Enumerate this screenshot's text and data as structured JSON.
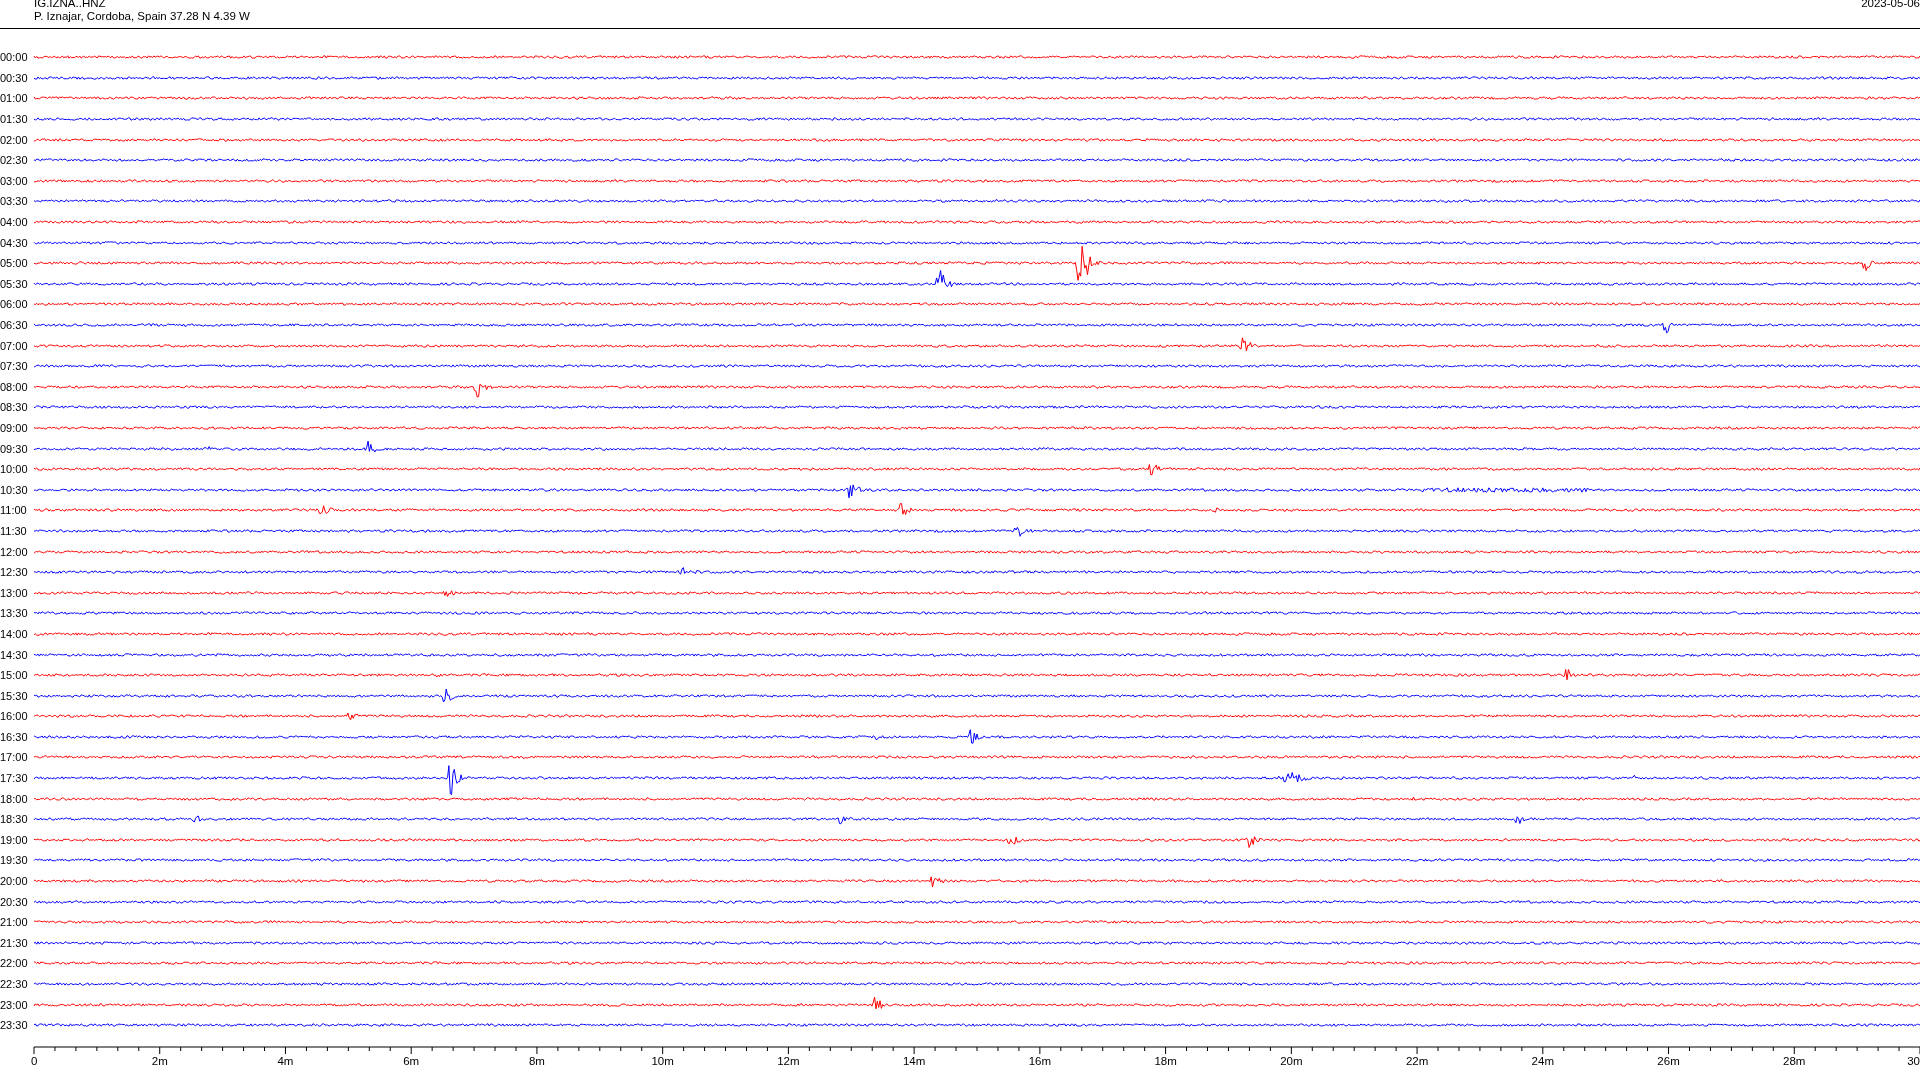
{
  "header": {
    "station": "IG.IZNA..HNZ",
    "location": "P. Iznajar, Cordoba, Spain  37.28 N 4.39 W",
    "date": "2023-05-06"
  },
  "rows": [
    {
      "label": "00:00",
      "color": "#ff0000"
    },
    {
      "label": "00:30",
      "color": "#0000ff"
    },
    {
      "label": "01:00",
      "color": "#ff0000"
    },
    {
      "label": "01:30",
      "color": "#0000ff"
    },
    {
      "label": "02:00",
      "color": "#ff0000"
    },
    {
      "label": "02:30",
      "color": "#0000ff"
    },
    {
      "label": "03:00",
      "color": "#ff0000"
    },
    {
      "label": "03:30",
      "color": "#0000ff"
    },
    {
      "label": "04:00",
      "color": "#ff0000"
    },
    {
      "label": "04:30",
      "color": "#0000ff"
    },
    {
      "label": "05:00",
      "color": "#ff0000"
    },
    {
      "label": "05:30",
      "color": "#0000ff"
    },
    {
      "label": "06:00",
      "color": "#ff0000"
    },
    {
      "label": "06:30",
      "color": "#0000ff"
    },
    {
      "label": "07:00",
      "color": "#ff0000"
    },
    {
      "label": "07:30",
      "color": "#0000ff"
    },
    {
      "label": "08:00",
      "color": "#ff0000"
    },
    {
      "label": "08:30",
      "color": "#0000ff"
    },
    {
      "label": "09:00",
      "color": "#ff0000"
    },
    {
      "label": "09:30",
      "color": "#0000ff"
    },
    {
      "label": "10:00",
      "color": "#ff0000"
    },
    {
      "label": "10:30",
      "color": "#0000ff"
    },
    {
      "label": "11:00",
      "color": "#ff0000"
    },
    {
      "label": "11:30",
      "color": "#0000ff"
    },
    {
      "label": "12:00",
      "color": "#ff0000"
    },
    {
      "label": "12:30",
      "color": "#0000ff"
    },
    {
      "label": "13:00",
      "color": "#ff0000"
    },
    {
      "label": "13:30",
      "color": "#0000ff"
    },
    {
      "label": "14:00",
      "color": "#ff0000"
    },
    {
      "label": "14:30",
      "color": "#0000ff"
    },
    {
      "label": "15:00",
      "color": "#ff0000"
    },
    {
      "label": "15:30",
      "color": "#0000ff"
    },
    {
      "label": "16:00",
      "color": "#ff0000"
    },
    {
      "label": "16:30",
      "color": "#0000ff"
    },
    {
      "label": "17:00",
      "color": "#ff0000"
    },
    {
      "label": "17:30",
      "color": "#0000ff"
    },
    {
      "label": "18:00",
      "color": "#ff0000"
    },
    {
      "label": "18:30",
      "color": "#0000ff"
    },
    {
      "label": "19:00",
      "color": "#ff0000"
    },
    {
      "label": "19:30",
      "color": "#0000ff"
    },
    {
      "label": "20:00",
      "color": "#ff0000"
    },
    {
      "label": "20:30",
      "color": "#0000ff"
    },
    {
      "label": "21:00",
      "color": "#ff0000"
    },
    {
      "label": "21:30",
      "color": "#0000ff"
    },
    {
      "label": "22:00",
      "color": "#ff0000"
    },
    {
      "label": "22:30",
      "color": "#0000ff"
    },
    {
      "label": "23:00",
      "color": "#ff0000"
    },
    {
      "label": "23:30",
      "color": "#0000ff"
    }
  ],
  "x_axis": {
    "labels": [
      "0",
      "2m",
      "4m",
      "6m",
      "8m",
      "10m",
      "12m",
      "14m",
      "16m",
      "18m",
      "20m",
      "22m",
      "24m",
      "26m",
      "28m",
      "30"
    ]
  }
}
